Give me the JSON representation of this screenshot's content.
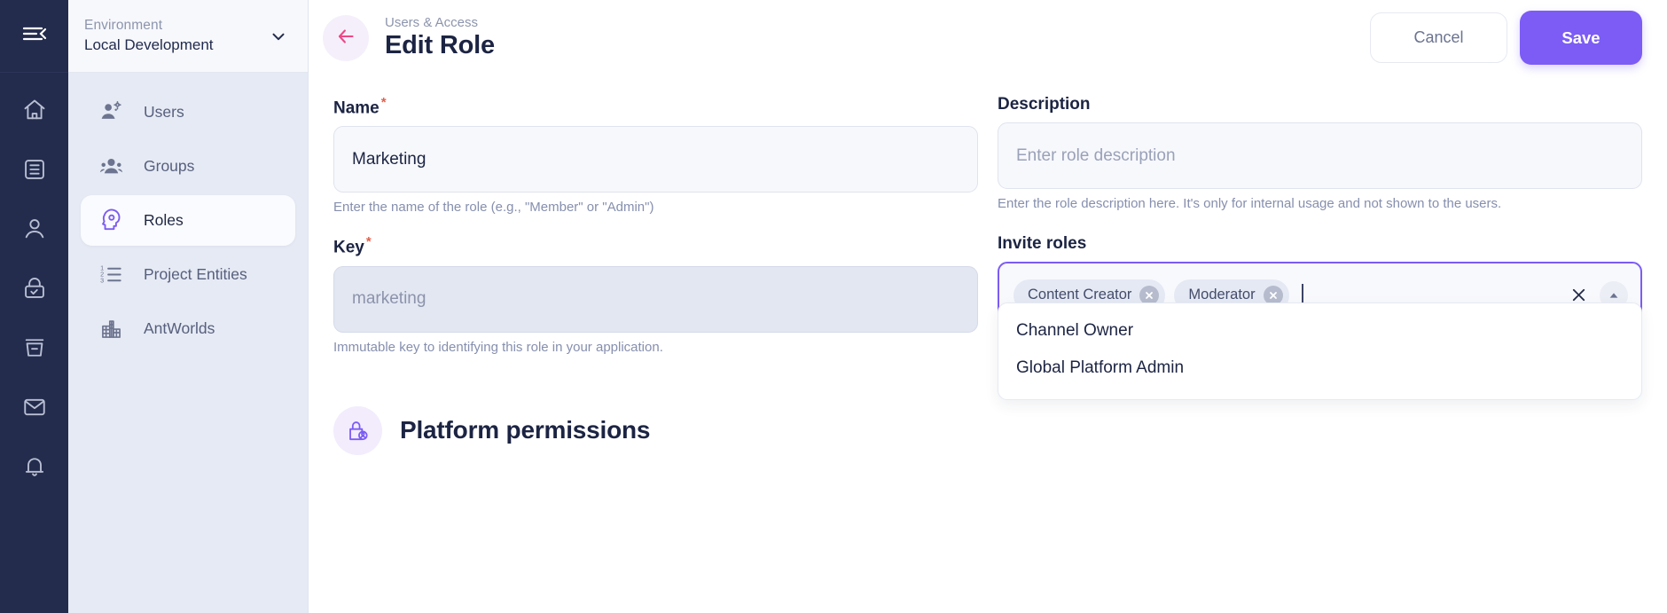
{
  "rail": {
    "collapse_icon": "menu-collapse-icon",
    "icons": [
      {
        "name": "home-icon"
      },
      {
        "name": "list-icon"
      },
      {
        "name": "person-icon"
      },
      {
        "name": "lock-check-icon"
      },
      {
        "name": "archive-icon"
      },
      {
        "name": "mail-icon"
      },
      {
        "name": "bell-icon"
      }
    ]
  },
  "environment": {
    "label": "Environment",
    "value": "Local Development",
    "chevron_icon": "chevron-down-icon"
  },
  "nav": {
    "items": [
      {
        "label": "Users",
        "icon": "user-settings-icon",
        "active": false
      },
      {
        "label": "Groups",
        "icon": "groups-icon",
        "active": false
      },
      {
        "label": "Roles",
        "icon": "head-gear-icon",
        "active": true
      },
      {
        "label": "Project Entities",
        "icon": "numbered-list-icon",
        "active": false
      },
      {
        "label": "AntWorlds",
        "icon": "buildings-icon",
        "active": false
      }
    ]
  },
  "header": {
    "back_icon": "back-arrow-icon",
    "breadcrumb": "Users & Access",
    "title": "Edit Role",
    "cancel_label": "Cancel",
    "save_label": "Save"
  },
  "form": {
    "name": {
      "label": "Name",
      "required": "*",
      "value": "Marketing",
      "hint": "Enter the name of the role (e.g., \"Member\" or \"Admin\")"
    },
    "description": {
      "label": "Description",
      "placeholder": "Enter role description",
      "value": "",
      "hint": "Enter the role description here. It's only for internal usage and not shown to the users."
    },
    "key": {
      "label": "Key",
      "required": "*",
      "value": "marketing",
      "hint": "Immutable key to identifying this role in your application."
    },
    "invite_roles": {
      "label": "Invite roles",
      "chips": [
        "Content Creator",
        "Moderator"
      ],
      "clear_icon": "close-icon",
      "toggle_icon": "chevron-up-icon",
      "options": [
        "Channel Owner",
        "Global Platform Admin"
      ]
    }
  },
  "permissions_section": {
    "icon": "lock-person-icon",
    "title": "Platform permissions"
  },
  "colors": {
    "rail_bg": "#232c4d",
    "nav_bg": "#e6eaf4",
    "accent": "#7c5cf5",
    "accent_soft": "#f2ecfd",
    "back_arrow": "#ef4786",
    "required": "#e2614d",
    "title": "#1c2443"
  }
}
